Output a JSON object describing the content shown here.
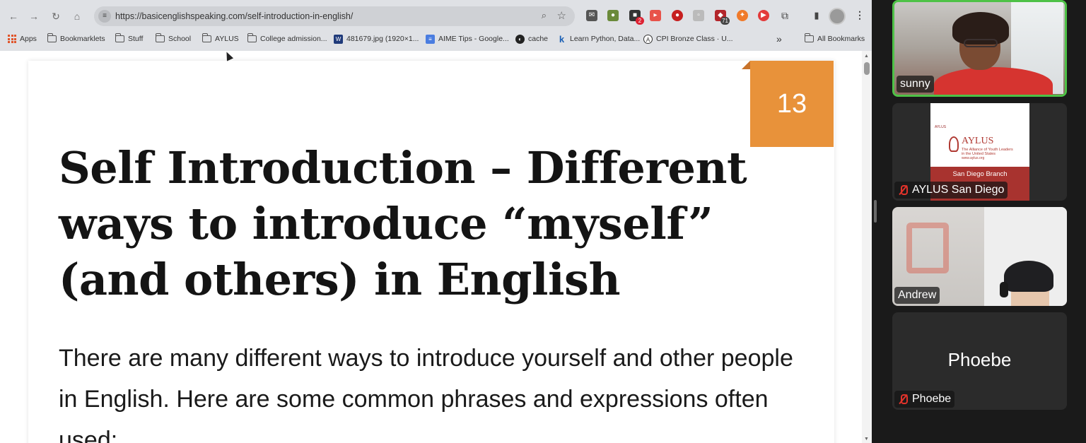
{
  "browser": {
    "url": "https://basicenglishspeaking.com/self-introduction-in-english/",
    "bookmarks": [
      {
        "label": "Apps",
        "icon": "apps-grid-icon"
      },
      {
        "label": "Bookmarklets",
        "icon": "folder-icon"
      },
      {
        "label": "Stuff",
        "icon": "folder-icon"
      },
      {
        "label": "School",
        "icon": "folder-icon"
      },
      {
        "label": "AYLUS",
        "icon": "folder-icon"
      },
      {
        "label": "College admission...",
        "icon": "folder-icon"
      },
      {
        "label": "481679.jpg (1920×1...",
        "icon": "image-favicon"
      },
      {
        "label": "AIME Tips - Google...",
        "icon": "docs-favicon"
      },
      {
        "label": "cache",
        "icon": "globe-favicon"
      },
      {
        "label": "Learn Python, Data...",
        "icon": "k-favicon"
      },
      {
        "label": "CPI Bronze Class · U...",
        "icon": "a-favicon"
      },
      {
        "label": "All Bookmarks",
        "icon": "folder-icon"
      }
    ],
    "extension_badges": {
      "ext2": "2",
      "ext7": "71"
    },
    "overflow_chevron": "»"
  },
  "article": {
    "number_badge": "13",
    "title": "Self Introduction – Different ways to introduce “myself” (and others) in English",
    "paragraph": "There are many different ways to introduce yourself and other people in English. Here are some common phrases and expressions often used:"
  },
  "participants": [
    {
      "name": "sunny",
      "muted": false,
      "active_speaker": true
    },
    {
      "name": "AYLUS San Diego",
      "muted": true
    },
    {
      "name": "Andrew",
      "muted": false
    },
    {
      "name": "Phoebe",
      "muted": true,
      "video_off": true
    }
  ],
  "aylus_slide": {
    "small_logo": "AYLUS",
    "brand": "AYLUS",
    "tag1": "The Alliance of Youth Leaders",
    "tag2": "in the United States",
    "tag3": "www.aylus.org",
    "branch": "San Diego Branch"
  },
  "colors": {
    "badge_orange": "#e8923a",
    "active_speaker_border": "#4ec247",
    "mute_red": "#e2332b",
    "aylus_red": "#a8332f"
  }
}
